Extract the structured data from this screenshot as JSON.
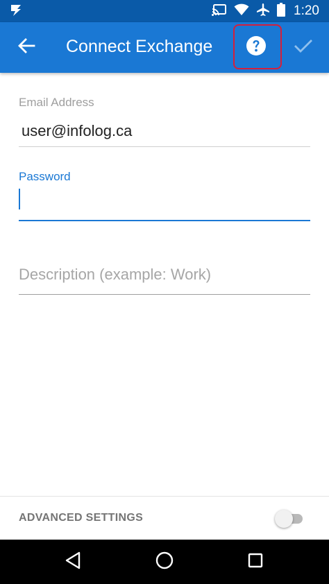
{
  "status_bar": {
    "time": "1:20",
    "icons": [
      "app-notification-icon",
      "cast-icon",
      "wifi-icon",
      "airplane-mode-icon",
      "battery-icon"
    ]
  },
  "app_bar": {
    "title": "Connect Exchange",
    "back_icon": "arrow-left-icon",
    "help_icon": "help-circle-icon",
    "confirm_icon": "checkmark-icon"
  },
  "form": {
    "email": {
      "label": "Email Address",
      "value": "user@infolog.ca"
    },
    "password": {
      "label": "Password",
      "value": ""
    },
    "description": {
      "placeholder": "Description (example: Work)",
      "value": ""
    }
  },
  "advanced_settings": {
    "label": "ADVANCED SETTINGS",
    "enabled": false
  },
  "nav_bar": {
    "icons": [
      "nav-back-icon",
      "nav-home-icon",
      "nav-recents-icon"
    ]
  },
  "colors": {
    "status_bar": "#0a5aa8",
    "app_bar": "#1a78d4",
    "accent": "#1a78d4",
    "highlight_box": "#d61f3a"
  }
}
